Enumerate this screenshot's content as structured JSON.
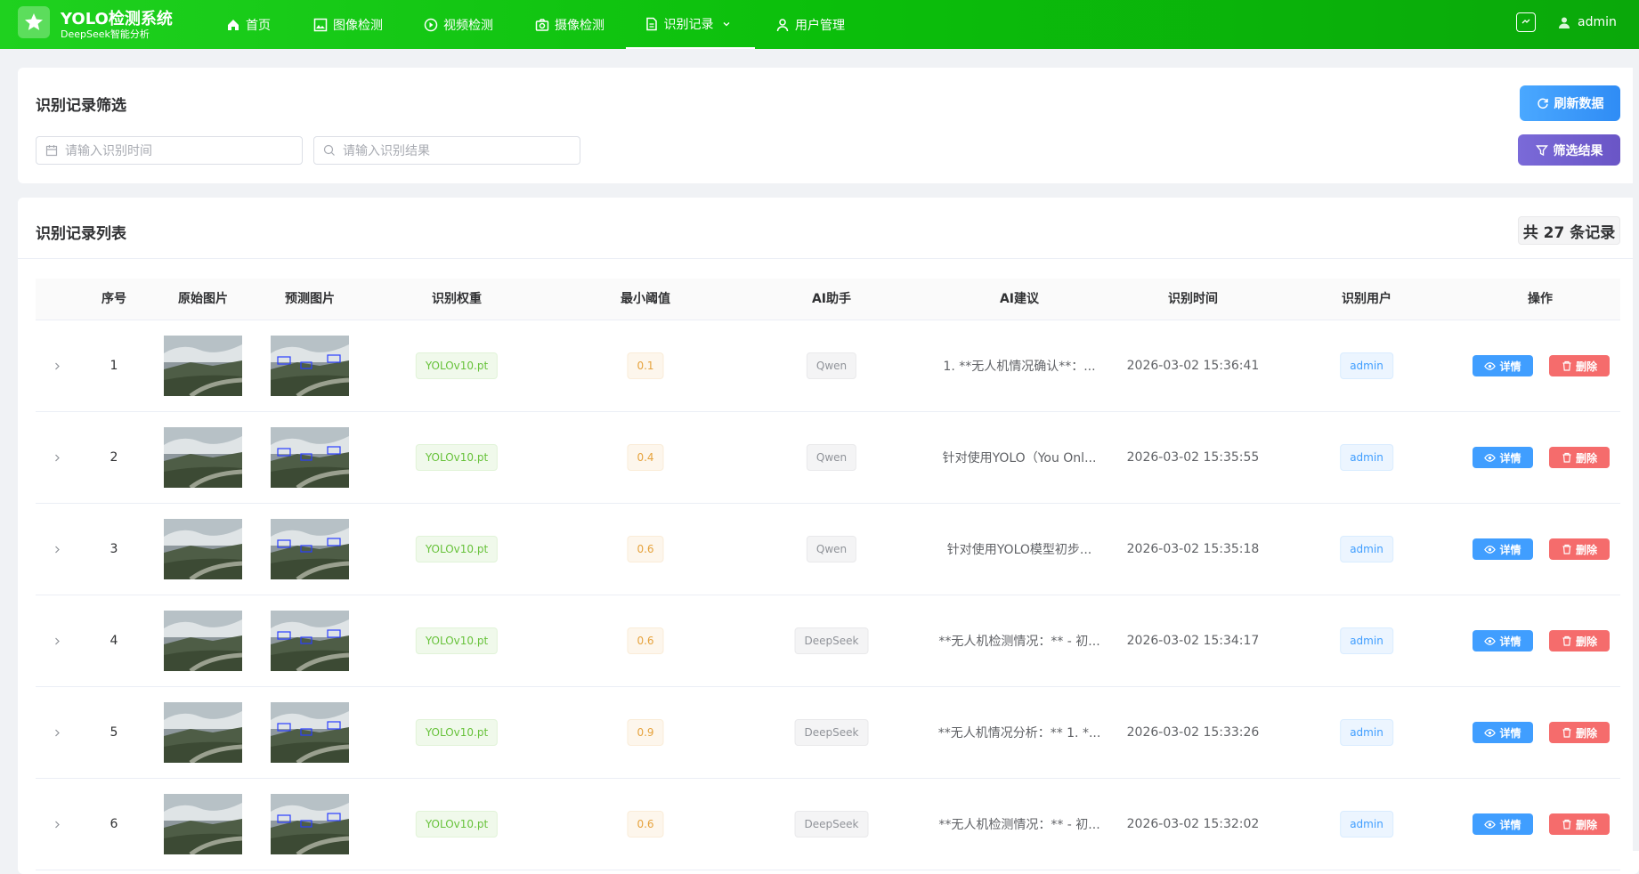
{
  "brand": {
    "title": "YOLO检测系统",
    "subtitle": "DeepSeek智能分析"
  },
  "nav": [
    {
      "label": "首页",
      "icon": "home-icon"
    },
    {
      "label": "图像检测",
      "icon": "image-icon"
    },
    {
      "label": "视频检测",
      "icon": "play-circle-icon"
    },
    {
      "label": "摄像检测",
      "icon": "camera-icon"
    },
    {
      "label": "识别记录",
      "icon": "document-icon",
      "active": true
    },
    {
      "label": "用户管理",
      "icon": "user-icon"
    }
  ],
  "header": {
    "username": "admin"
  },
  "filter": {
    "title": "识别记录筛选",
    "time_placeholder": "请输入识别时间",
    "result_placeholder": "请输入识别结果",
    "refresh_label": "刷新数据",
    "filter_label": "筛选结果"
  },
  "list": {
    "title": "识别记录列表",
    "count_label": "共 27 条记录",
    "columns": [
      "序号",
      "原始图片",
      "预测图片",
      "识别权重",
      "最小阈值",
      "AI助手",
      "AI建议",
      "识别时间",
      "识别用户",
      "操作"
    ],
    "rows": [
      {
        "index": "1",
        "weight": "YOLOv10.pt",
        "threshold": "0.1",
        "assistant": "Qwen",
        "advice": "1. **无人机情况确认**：...",
        "time": "2026-03-02 15:36:41",
        "user": "admin"
      },
      {
        "index": "2",
        "weight": "YOLOv10.pt",
        "threshold": "0.4",
        "assistant": "Qwen",
        "advice": "针对使用YOLO（You Onl...",
        "time": "2026-03-02 15:35:55",
        "user": "admin"
      },
      {
        "index": "3",
        "weight": "YOLOv10.pt",
        "threshold": "0.6",
        "assistant": "Qwen",
        "advice": "针对使用YOLO模型初步...",
        "time": "2026-03-02 15:35:18",
        "user": "admin"
      },
      {
        "index": "4",
        "weight": "YOLOv10.pt",
        "threshold": "0.6",
        "assistant": "DeepSeek",
        "advice": "**无人机检测情况：** - 初...",
        "time": "2026-03-02 15:34:17",
        "user": "admin"
      },
      {
        "index": "5",
        "weight": "YOLOv10.pt",
        "threshold": "0.9",
        "assistant": "DeepSeek",
        "advice": "**无人机情况分析：** 1. *...",
        "time": "2026-03-02 15:33:26",
        "user": "admin"
      },
      {
        "index": "6",
        "weight": "YOLOv10.pt",
        "threshold": "0.6",
        "assistant": "DeepSeek",
        "advice": "**无人机检测情况：** - 初...",
        "time": "2026-03-02 15:32:02",
        "user": "admin"
      }
    ],
    "detail_label": "详情",
    "delete_label": "删除"
  },
  "colors": {
    "header_green": "#0bbf0b",
    "primary": "#409eff",
    "danger": "#f56c6c",
    "purple": "#6a55c6"
  }
}
